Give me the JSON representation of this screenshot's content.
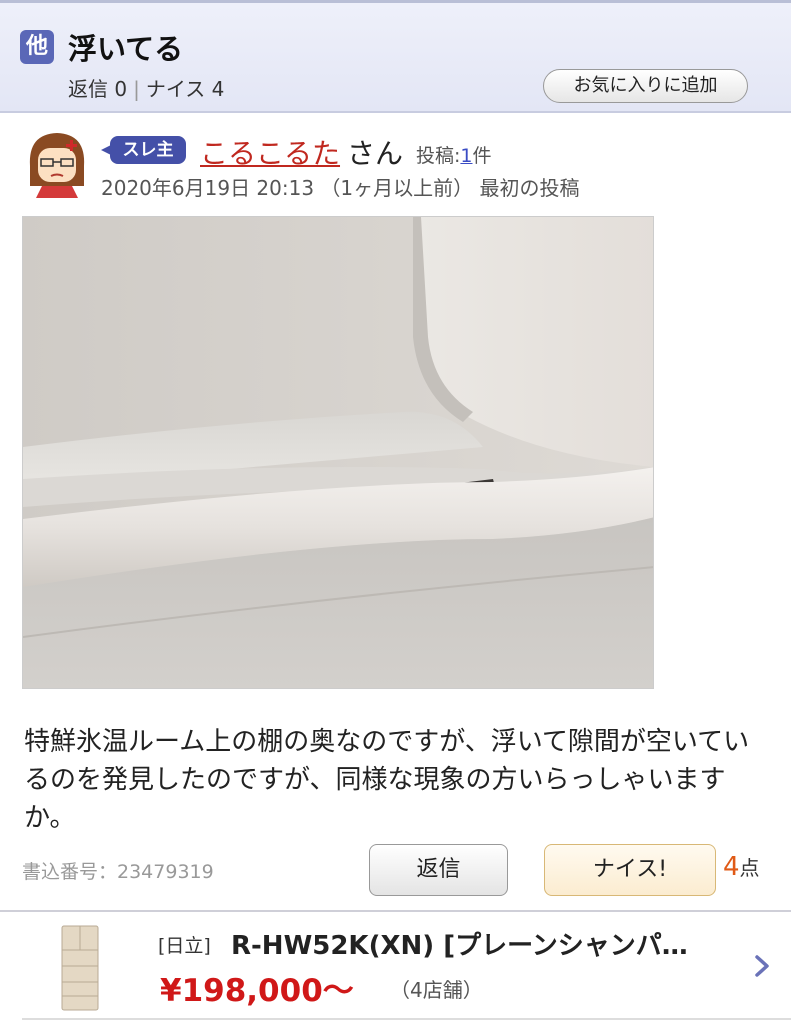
{
  "header": {
    "category_badge": "他",
    "title": "浮いてる",
    "replies_label": "返信 0",
    "nice_label": "ナイス 4",
    "favorite_button": "お気に入りに追加"
  },
  "post": {
    "thread_owner_badge": "スレ主",
    "username": "こるこるた",
    "honorific": "さん",
    "post_count_prefix": "投稿:",
    "post_count_number": "1",
    "post_count_suffix": "件",
    "datetime": "2020年6月19日 20:13 （1ヶ月以上前） 最初の投稿",
    "body": "特鮮氷温ルーム上の棚の奥なのですが、浮いて隙間が空いているのを発見したのですが、同様な現象の方いらっしゃいますか。",
    "post_number": "書込番号：23479319",
    "reply_button": "返信",
    "nice_button": "ナイス!",
    "nice_count": "4",
    "nice_unit": "点"
  },
  "product": {
    "maker": "[日立]",
    "name": "R-HW52K(XN) [プレーンシャンパ…",
    "price": "¥198,000〜",
    "shops": "（4店舗）"
  },
  "colors": {
    "accent_blue": "#4450a8",
    "username_red": "#c0281f",
    "price_red": "#d01818",
    "nice_orange": "#e05a16"
  }
}
